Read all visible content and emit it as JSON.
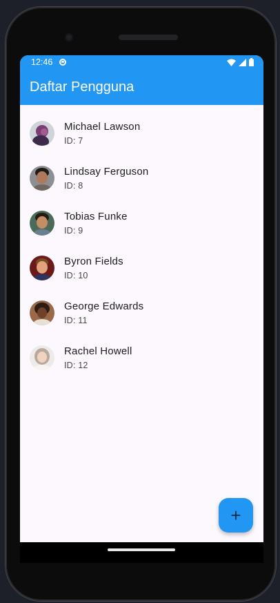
{
  "status_bar": {
    "time": "12:46",
    "icons": [
      "sync-icon",
      "wifi-icon",
      "signal-icon",
      "battery-icon"
    ]
  },
  "app_bar": {
    "title": "Daftar Pengguna"
  },
  "users": [
    {
      "name": "Michael Lawson",
      "id_label": "ID: 7"
    },
    {
      "name": "Lindsay Ferguson",
      "id_label": "ID: 8"
    },
    {
      "name": "Tobias Funke",
      "id_label": "ID: 9"
    },
    {
      "name": "Byron Fields",
      "id_label": "ID: 10"
    },
    {
      "name": "George Edwards",
      "id_label": "ID: 11"
    },
    {
      "name": "Rachel Howell",
      "id_label": "ID: 12"
    }
  ],
  "fab": {
    "label": "+",
    "icon": "add-icon"
  },
  "colors": {
    "primary": "#2196f3",
    "background": "#fdf8fd",
    "on_primary": "#ffffff"
  }
}
